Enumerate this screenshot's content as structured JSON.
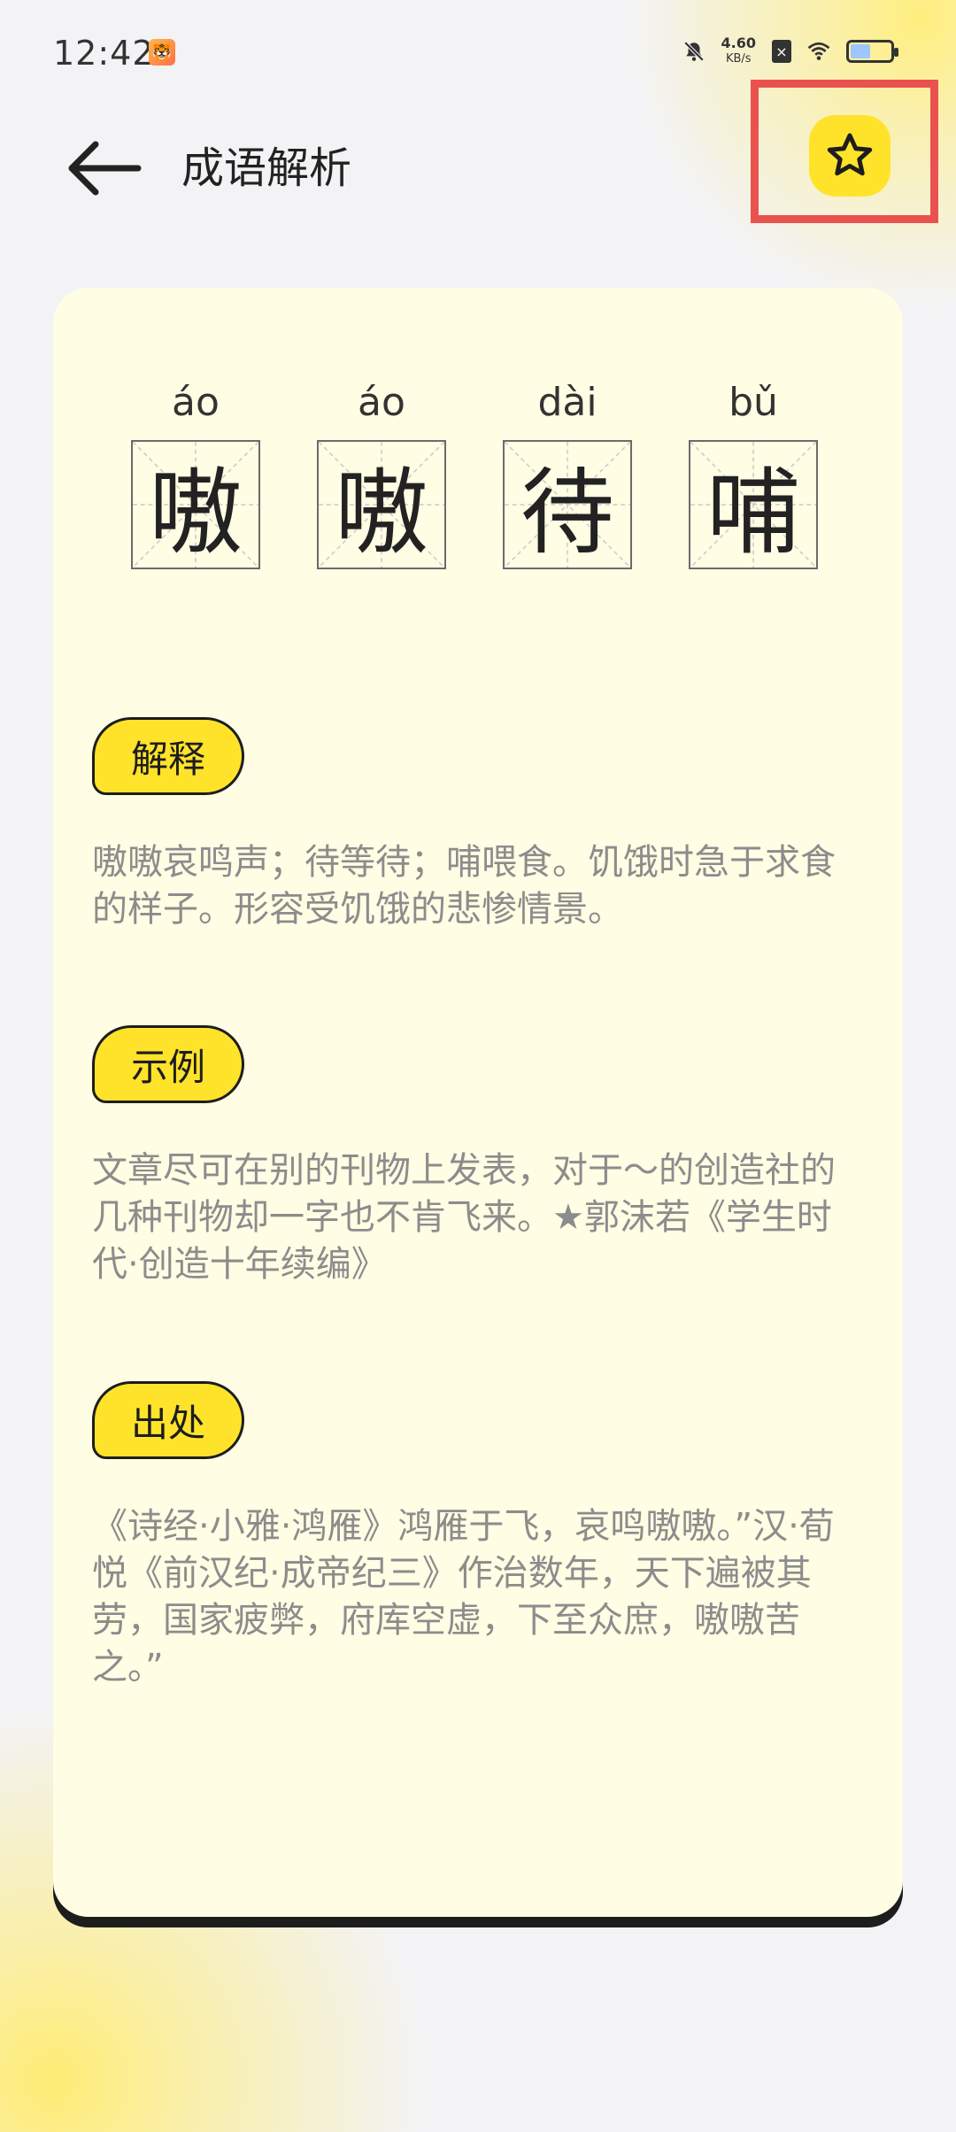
{
  "status_bar": {
    "time": "12:42",
    "net_speed_value": "4.60",
    "net_speed_unit": "KB/s"
  },
  "header": {
    "title": "成语解析"
  },
  "idiom": {
    "characters": [
      {
        "pinyin": "áo",
        "char": "嗷"
      },
      {
        "pinyin": "áo",
        "char": "嗷"
      },
      {
        "pinyin": "dài",
        "char": "待"
      },
      {
        "pinyin": "bǔ",
        "char": "哺"
      }
    ]
  },
  "sections": {
    "explanation": {
      "label": "解释",
      "text": "嗷嗷哀鸣声；待等待；哺喂食。饥饿时急于求食的样子。形容受饥饿的悲惨情景。"
    },
    "example": {
      "label": "示例",
      "text": "文章尽可在别的刊物上发表，对于～的创造社的几种刊物却一字也不肯飞来。★郭沫若《学生时代·创造十年续编》"
    },
    "source": {
      "label": "出处",
      "text": "《诗经·小雅·鸿雁》鸿雁于飞，哀鸣嗷嗷。”汉·荀悦《前汉纪·成帝纪三》作治数年，天下遍被其劳，国家疲弊，府库空虚，下至众庶，嗷嗷苦之。”"
    }
  },
  "colors": {
    "accent_yellow": "#ffe32b",
    "card_bg": "#fffde4",
    "highlight_red": "#e9524f"
  },
  "icons": {
    "back": "arrow-left-icon",
    "favorite": "star-icon"
  }
}
